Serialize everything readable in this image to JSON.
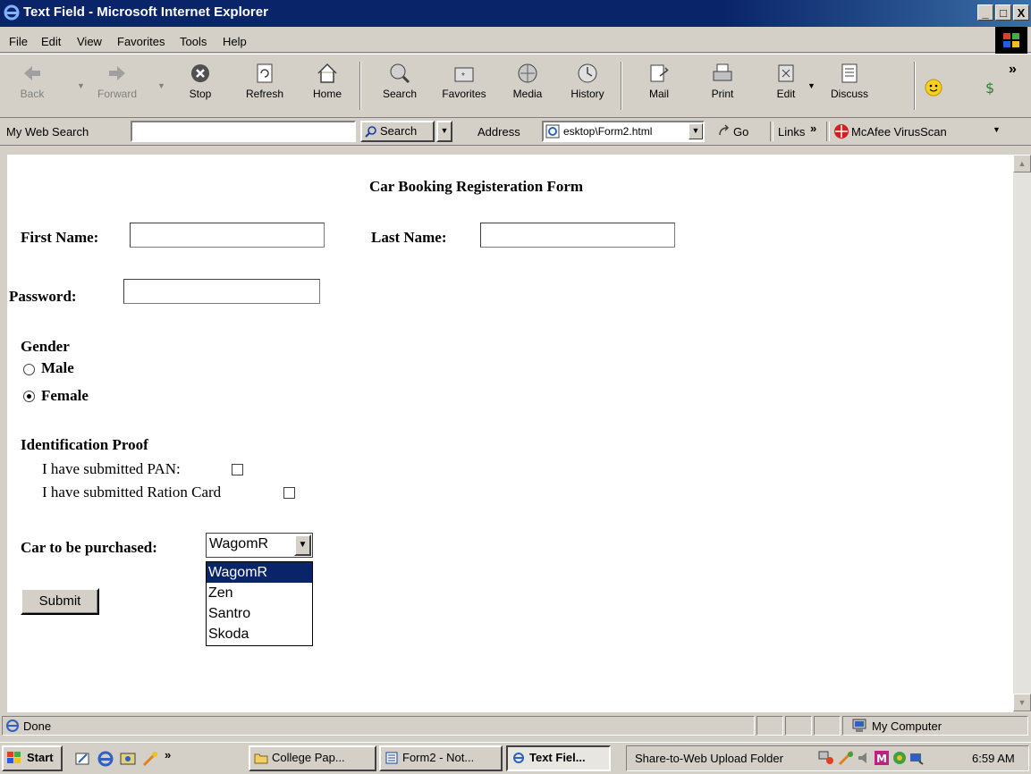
{
  "window": {
    "title": "Text Field - Microsoft Internet Explorer",
    "min": "_",
    "max": "□",
    "close": "X"
  },
  "menu": [
    "File",
    "Edit",
    "View",
    "Favorites",
    "Tools",
    "Help"
  ],
  "toolbar": {
    "back": "Back",
    "forward": "Forward",
    "stop": "Stop",
    "refresh": "Refresh",
    "home": "Home",
    "search": "Search",
    "favorites": "Favorites",
    "media": "Media",
    "history": "History",
    "mail": "Mail",
    "print": "Print",
    "edit": "Edit",
    "discuss": "Discuss",
    "more": "»"
  },
  "addressbar": {
    "my_web_search": "My Web Search",
    "search_value": "",
    "search_button": "Search",
    "address_label": "Address",
    "address_value": "esktop\\Form2.html",
    "go": "Go",
    "links": "Links",
    "links_more": "»",
    "mcafee": "McAfee VirusScan"
  },
  "form": {
    "heading": "Car Booking Registeration Form",
    "first_name_label": "First Name:",
    "first_name_value": "",
    "last_name_label": "Last Name:",
    "last_name_value": "",
    "password_label": "Password:",
    "password_value": "",
    "gender_label": "Gender",
    "gender_options": [
      "Male",
      "Female"
    ],
    "gender_selected": "Female",
    "id_proof_label": "Identification Proof",
    "pan_label": "I have submitted PAN:",
    "ration_label": "I have submitted Ration Card",
    "pan_checked": false,
    "ration_checked": false,
    "car_label": "Car to be purchased:",
    "car_selected": "WagomR",
    "car_options": [
      "WagomR",
      "Zen",
      "Santro",
      "Skoda"
    ],
    "submit": "Submit"
  },
  "statusbar": {
    "text": "Done",
    "zone": "My Computer"
  },
  "taskbar": {
    "start": "Start",
    "quicklaunch_more": "»",
    "tasks": [
      "College Pap...",
      "Form2 - Not...",
      "Text Fiel..."
    ],
    "share": "Share-to-Web Upload Folder",
    "time": "6:59 AM"
  },
  "colors": {
    "titlebar": "#0a246a",
    "chrome": "#d4d0c8",
    "selection": "#0a246a"
  }
}
